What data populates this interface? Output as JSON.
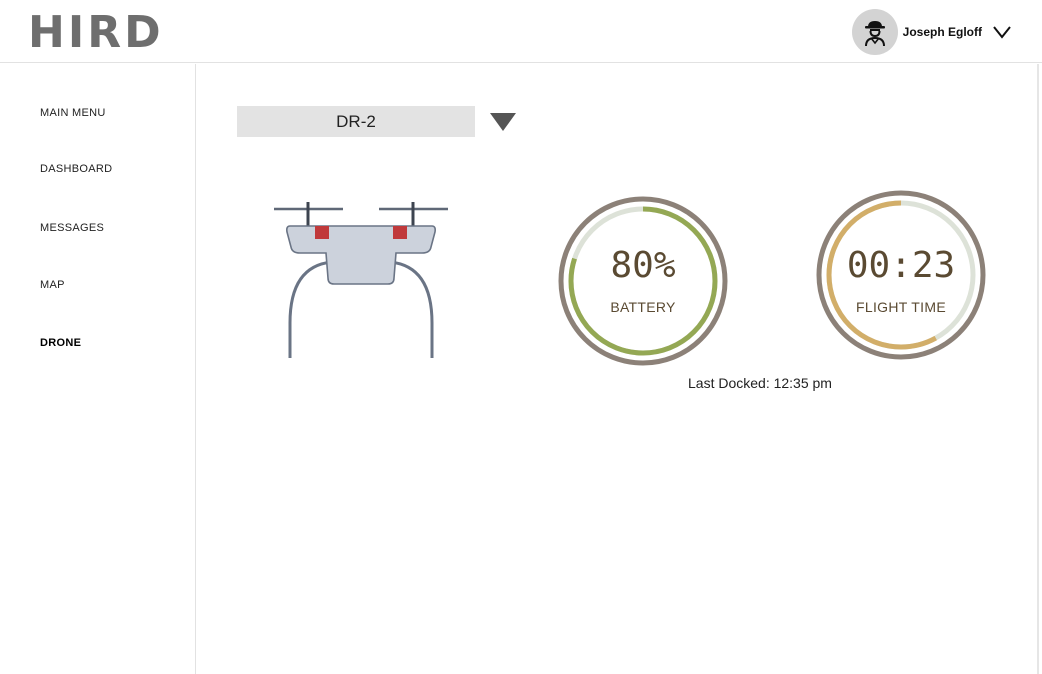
{
  "header": {
    "logo": "HIRD",
    "user_name": "Joseph Egloff",
    "avatar_icon": "explorer-avatar-icon",
    "menu_icon": "chevron-down-icon"
  },
  "sidebar": {
    "items": [
      {
        "label": "MAIN MENU",
        "active": false
      },
      {
        "label": "DASHBOARD",
        "active": false
      },
      {
        "label": "MESSAGES",
        "active": false
      },
      {
        "label": "MAP",
        "active": false
      },
      {
        "label": "DRONE",
        "active": true
      }
    ]
  },
  "drone_select": {
    "value": "DR-2",
    "arrow_icon": "triangle-down-icon"
  },
  "drone_image": {
    "icon": "drone-icon"
  },
  "gauges": {
    "battery": {
      "value": "80%",
      "label": "BATTERY",
      "fraction": 0.8,
      "color": "#94a854",
      "track": "#dde2d8",
      "ring": "#8c8178"
    },
    "flight_time": {
      "value": "00:23",
      "label": "FLIGHT TIME",
      "fraction": 0.58,
      "color": "#d2ae69",
      "track": "#dde2d8",
      "ring": "#8c8178"
    }
  },
  "last_docked": "Last Docked: 12:35 pm"
}
